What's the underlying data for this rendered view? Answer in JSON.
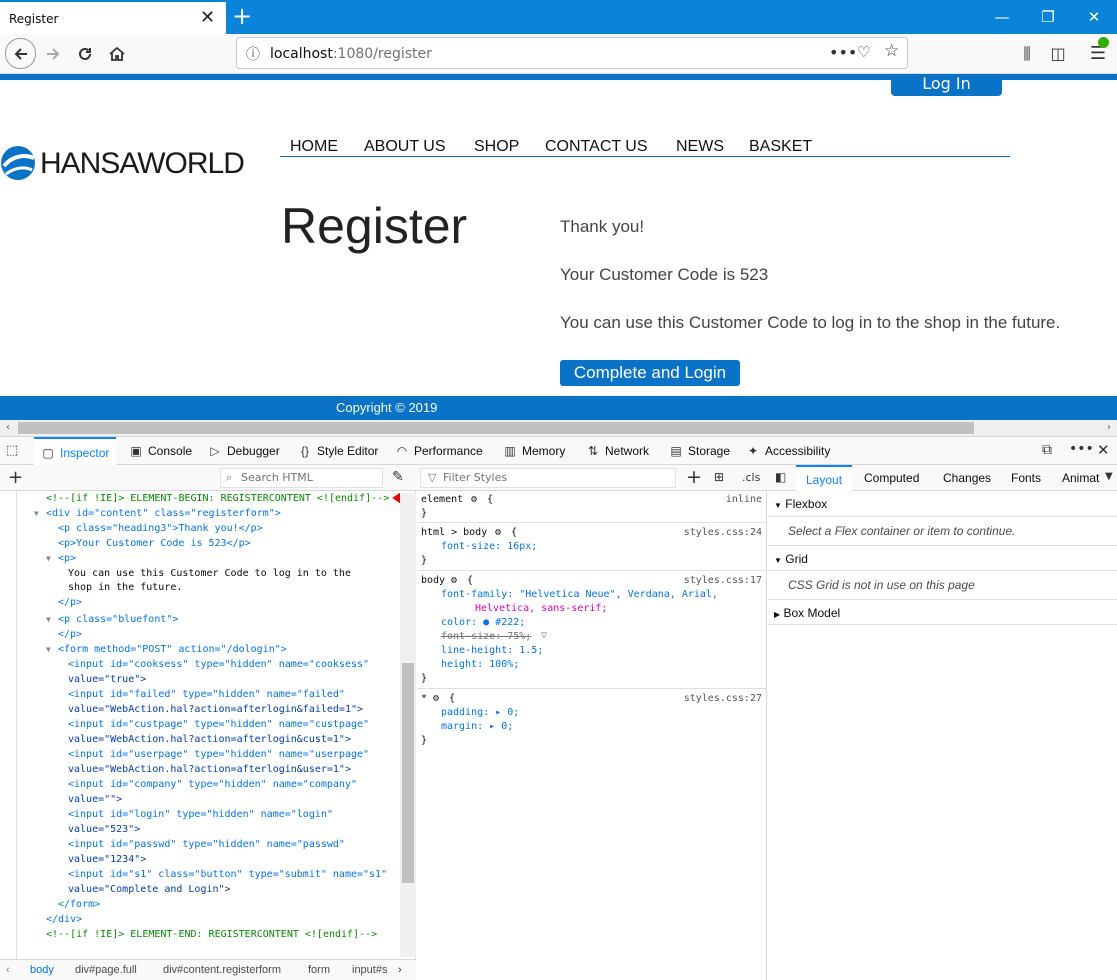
{
  "browser": {
    "tab_title": "Register",
    "tab_close": "✕",
    "new_tab": "+",
    "url_host": "localhost",
    "url_path": ":1080/register",
    "window_controls": [
      "—",
      "❐",
      "✕"
    ]
  },
  "site": {
    "login_label": "Log In",
    "logo_text": "HANSAWORLD",
    "menu": [
      "HOME",
      "ABOUT US",
      "SHOP",
      "CONTACT US",
      "NEWS",
      "BASKET"
    ],
    "page_title": "Register",
    "thanks": "Thank you!",
    "customer_code_line": "Your Customer Code is 523",
    "info_line": "You can use this Customer Code to log in to the shop in the future.",
    "complete_button": "Complete and Login",
    "copyright": "Copyright © 2019",
    "brand_color": "#0a73c8"
  },
  "devtools": {
    "tabs": [
      "Inspector",
      "Console",
      "Debugger",
      "Style Editor",
      "Performance",
      "Memory",
      "Network",
      "Storage",
      "Accessibility"
    ],
    "search_html_placeholder": "Search HTML",
    "filter_styles_placeholder": "Filter Styles",
    "cls_label": ".cls",
    "side_tabs": [
      "Layout",
      "Computed",
      "Changes",
      "Fonts",
      "Animat"
    ],
    "markup_lines": [
      "<!--[if !IE]> ELEMENT-BEGIN: REGISTERCONTENT <![endif]-->",
      "<div id=\"content\" class=\"registerform\">",
      "<p class=\"heading3\">Thank you!</p>",
      "<p>Your Customer Code is 523</p>",
      "<p>",
      "You can use this Customer Code to log in to the",
      "shop in the future.",
      "</p>",
      "<p class=\"bluefont\">",
      "</p>",
      "<form method=\"POST\" action=\"/dologin\">",
      "<input id=\"cooksess\" type=\"hidden\" name=\"cooksess\"",
      "value=\"true\">",
      "<input id=\"failed\" type=\"hidden\" name=\"failed\"",
      "value=\"WebAction.hal?action=afterlogin&failed=1\">",
      "<input id=\"custpage\" type=\"hidden\" name=\"custpage\"",
      "value=\"WebAction.hal?action=afterlogin&cust=1\">",
      "<input id=\"userpage\" type=\"hidden\" name=\"userpage\"",
      "value=\"WebAction.hal?action=afterlogin&user=1\">",
      "<input id=\"company\" type=\"hidden\" name=\"company\"",
      "value=\"\">",
      "<input id=\"login\" type=\"hidden\" name=\"login\"",
      "value=\"523\">",
      "<input id=\"passwd\" type=\"hidden\" name=\"passwd\"",
      "value=\"1234\">",
      "<input id=\"s1\" class=\"button\" type=\"submit\" name=\"s1\"",
      "value=\"Complete and Login\">",
      "</form>",
      "</div>",
      "<!--[if !IE]> ELEMENT-END: REGISTERCONTENT <![endif]-->"
    ],
    "rules": {
      "element_sel": "element",
      "element_src": "inline",
      "html_body_sel": "html > body",
      "html_body_src": "styles.css:24",
      "html_body_decl": "font-size: 16px;",
      "body_sel": "body",
      "body_src": "styles.css:17",
      "body_decls": [
        "font-family: \"Helvetica Neue\", Verdana, Arial,",
        "Helvetica, sans-serif;",
        "color: ● #222;",
        "font-size: 75%;",
        "line-height: 1.5;",
        "height: 100%;"
      ],
      "star_sel": "*",
      "star_src": "styles.css:27",
      "star_decls": [
        "padding: ▸ 0;",
        "margin: ▸ 0;"
      ],
      "open_brace": "{",
      "close_brace": "}"
    },
    "layout": {
      "flexbox_label": "Flexbox",
      "flexbox_msg": "Select a Flex container or item to continue.",
      "grid_label": "Grid",
      "grid_msg": "CSS Grid is not in use on this page",
      "boxmodel_label": "Box Model"
    },
    "breadcrumbs": [
      "body",
      "div#page.full",
      "div#content.registerform",
      "form",
      "input#s"
    ]
  }
}
